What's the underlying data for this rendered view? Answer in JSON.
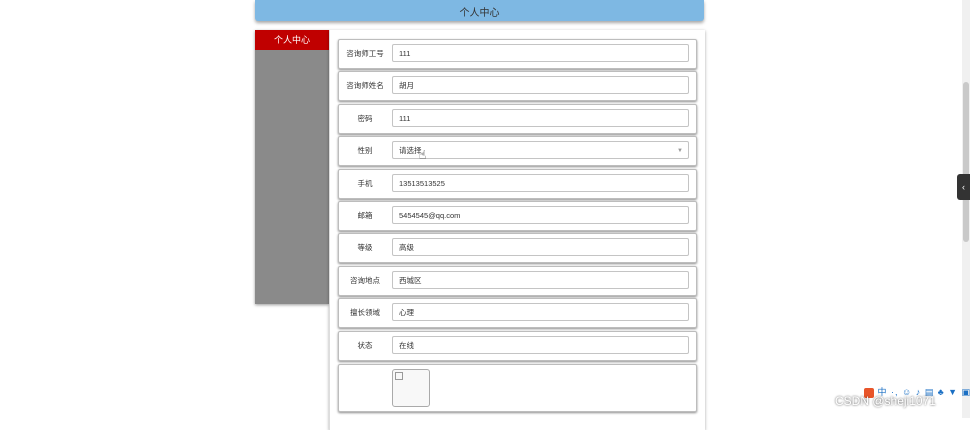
{
  "header": {
    "title": "个人中心"
  },
  "sidebar": {
    "items": [
      {
        "label": "个人中心"
      }
    ]
  },
  "form": {
    "fields": [
      {
        "label": "咨询师工号",
        "value": "111"
      },
      {
        "label": "咨询师姓名",
        "value": "胡月"
      },
      {
        "label": "密码",
        "value": "111"
      },
      {
        "label": "性别",
        "value": "请选择",
        "type": "select"
      },
      {
        "label": "手机",
        "value": "13513513525"
      },
      {
        "label": "邮箱",
        "value": "5454545@qq.com"
      },
      {
        "label": "等级",
        "value": "高级"
      },
      {
        "label": "咨询地点",
        "value": "西城区"
      },
      {
        "label": "擅长领域",
        "value": "心理"
      },
      {
        "label": "状态",
        "value": "在线"
      }
    ]
  },
  "side_tab": {
    "icon": "chevron-left-icon",
    "glyph": "‹"
  },
  "toolbar": {
    "text": "中 ·, ☺ ♪ ▤ ♣ ▼ ▣"
  },
  "watermark": {
    "text": "CSDN @sheji1071"
  },
  "colors": {
    "header": "#7eb8e3",
    "sidebar_active": "#c00000",
    "sidebar_bg": "#8a8a8a"
  }
}
